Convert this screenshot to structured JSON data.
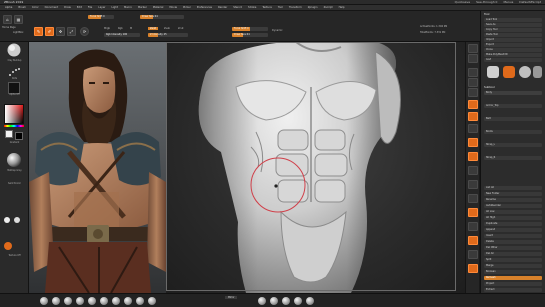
{
  "window": {
    "title": "ZBrush 2019",
    "right_items": [
      "Quicksave",
      "See-through 0",
      "Menus",
      "DefaultZScript"
    ]
  },
  "menu": [
    "Alpha",
    "Brush",
    "Color",
    "Document",
    "Draw",
    "Edit",
    "File",
    "Layer",
    "Light",
    "Macro",
    "Marker",
    "Material",
    "Movie",
    "Picker",
    "Preferences",
    "Render",
    "Stencil",
    "Stroke",
    "Texture",
    "Tool",
    "Transform",
    "Zplugin",
    "Zscript",
    "Help"
  ],
  "shelf": {
    "left_buttons": [
      "Home Page",
      "LightBox"
    ],
    "edit_label": "Edit",
    "draw_label": "Draw",
    "move_label": "Move",
    "scale_label": "Scale",
    "rotate_label": "Rotate",
    "mrgb_label": "Mrgb",
    "rgb_label": "Rgb",
    "m_label": "M",
    "zadd_label": "Zadd",
    "zsub_label": "Zsub",
    "zcut_label": "Zcut",
    "focal_label": "Focal Shift 0",
    "draw_size_label": "Draw Size 64",
    "dynamic_label": "Dynamic",
    "z_intensity_label": "Z Intensity 25",
    "rgb_intensity_label": "Rgb Intensity 100",
    "active_points": "ActivePoints: 1.394 Mil",
    "total_points": "TotalPoints: 7.331 Mil"
  },
  "left_tray": {
    "brush_label": "Clay Buildup",
    "stroke_label": "Dots",
    "alpha_label": "Alpha Off",
    "texture_label": "Texture Off",
    "material_label": "MatCap Gray",
    "gradient_label": "Gradient",
    "switch_color_label": "SwitchColor"
  },
  "right_panel": {
    "header": "Tool",
    "rows": [
      "Load Tool",
      "Save As",
      "Copy Tool",
      "Paste Tool",
      "Import",
      "Export",
      "Clone",
      "Make PolyMesh3D",
      "GoZ",
      "All",
      "Visible",
      "R"
    ],
    "subtool_header": "Subtool",
    "subtools": [
      "Body",
      "Armor_Top",
      "Belt",
      "Boots",
      "Strap_L",
      "Strap_R"
    ],
    "lower_rows": [
      "List All",
      "New Folder",
      "Rename",
      "AutoReorder",
      "All Low",
      "All High",
      "Duplicate",
      "Append",
      "Insert",
      "Delete",
      "Del Other",
      "Del All",
      "Split",
      "Merge",
      "Boolean",
      "Remesh",
      "Project",
      "Extract"
    ]
  },
  "right_shelf": [
    "Bpr",
    "SPix 3",
    "Scroll",
    "Zoom",
    "Actual",
    "AAHalf",
    "Persp",
    "Floor",
    "Local",
    "Frame",
    "Move",
    "Zoom3D",
    "Rotate",
    "Line Fill",
    "PolyF",
    "Transp",
    "Solo",
    "Xpose"
  ],
  "bottom": {
    "brushes": [
      "Standard",
      "Move",
      "ClayBuildup",
      "DamStandard",
      "hPolish",
      "TrimDynamic",
      "Inflat",
      "Pinch",
      "Smooth",
      "SnakeHook"
    ],
    "center_label": "Mirror"
  },
  "colors": {
    "accent": "#e06a1b",
    "panel": "#2c2c2c",
    "viewport": "#2b2b2b",
    "clay": "#d9d9d9"
  }
}
